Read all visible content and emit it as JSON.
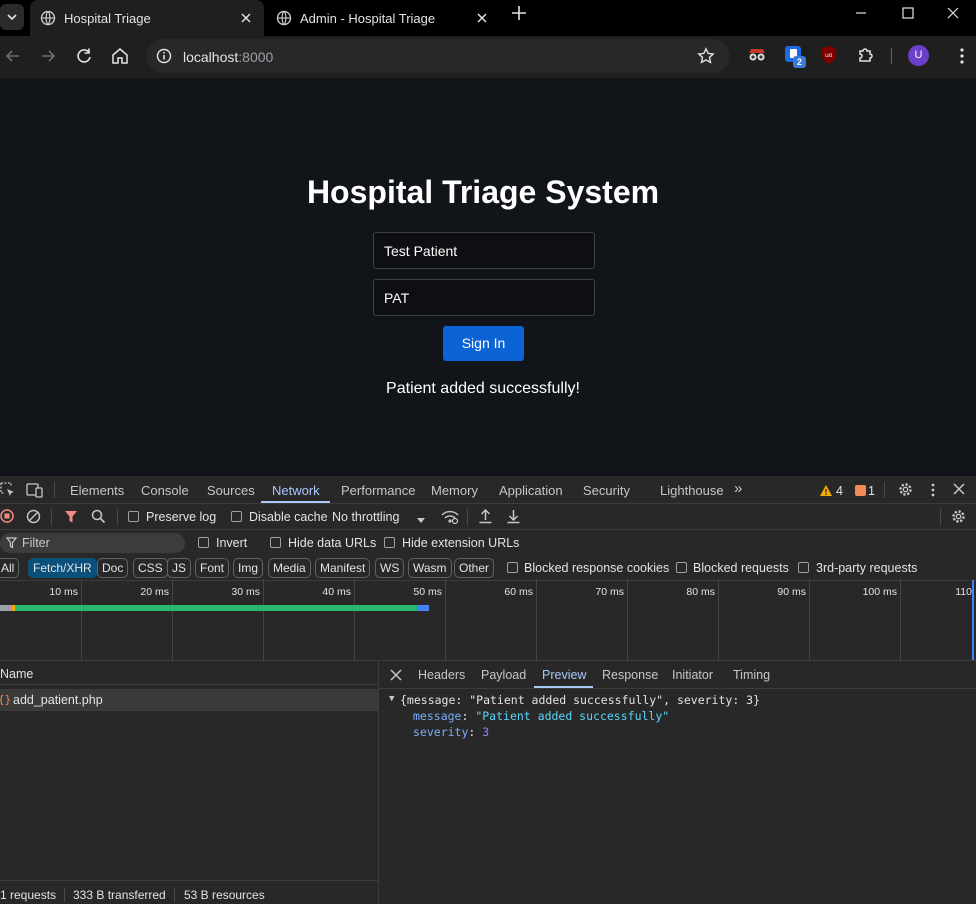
{
  "browser": {
    "tabs": [
      {
        "title": "Hospital Triage",
        "active": true
      },
      {
        "title": "Admin - Hospital Triage",
        "active": false
      }
    ],
    "url_host": "localhost",
    "url_port": ":8000",
    "profile_initial": "U",
    "extension_badge": "2"
  },
  "page": {
    "title": "Hospital Triage System",
    "name_value": "Test Patient",
    "code_value": "PAT",
    "signin_label": "Sign In",
    "status_message": "Patient added successfully!"
  },
  "devtools": {
    "tabs": [
      "Elements",
      "Console",
      "Sources",
      "Network",
      "Performance",
      "Memory",
      "Application",
      "Security",
      "Lighthouse"
    ],
    "active_tab": "Network",
    "warnings": "4",
    "issues": "1",
    "preserve_log": "Preserve log",
    "disable_cache": "Disable cache",
    "throttling": "No throttling",
    "filter_placeholder": "Filter",
    "invert": "Invert",
    "hide_data_urls": "Hide data URLs",
    "hide_ext_urls": "Hide extension URLs",
    "type_filters": [
      "All",
      "Fetch/XHR",
      "Doc",
      "CSS",
      "JS",
      "Font",
      "Img",
      "Media",
      "Manifest",
      "WS",
      "Wasm",
      "Other"
    ],
    "active_filter": "Fetch/XHR",
    "blocked_cookies": "Blocked response cookies",
    "blocked_requests": "Blocked requests",
    "third_party": "3rd-party requests",
    "timeline_ticks": [
      "10 ms",
      "20 ms",
      "30 ms",
      "40 ms",
      "50 ms",
      "60 ms",
      "70 ms",
      "80 ms",
      "90 ms",
      "100 ms",
      "110"
    ],
    "name_header": "Name",
    "request_name": "add_patient.php",
    "detail_tabs": [
      "Headers",
      "Payload",
      "Preview",
      "Response",
      "Initiator",
      "Timing"
    ],
    "active_detail_tab": "Preview",
    "preview_summary": "{message: \"Patient added successfully\", severity: 3}",
    "preview_key_message": "message",
    "preview_val_message": "\"Patient added successfully\"",
    "preview_key_severity": "severity",
    "preview_val_severity": "3",
    "status_requests": "1 requests",
    "status_transferred": "333 B transferred",
    "status_resources": "53 B resources"
  },
  "colors": {
    "page_bg": "#111419",
    "button_blue": "#0b63d6",
    "devtools_bg": "#282828",
    "accent": "#a8c7fa"
  }
}
